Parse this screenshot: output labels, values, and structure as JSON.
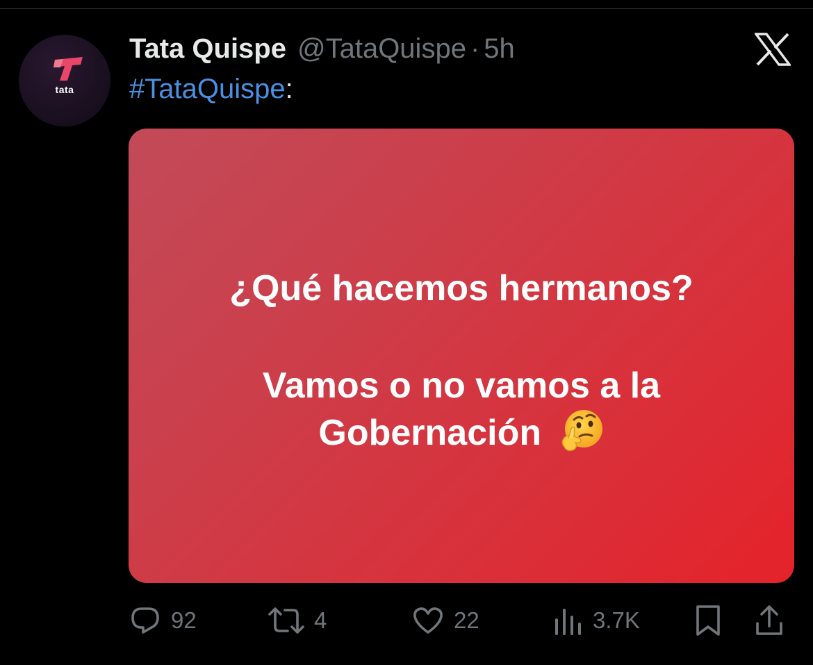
{
  "tweet": {
    "display_name": "Tata Quispe",
    "handle": "@TataQuispe",
    "separator": "·",
    "time": "5h",
    "hashtag": "#TataQuispe",
    "after_hashtag": ":",
    "avatar_label": "tata"
  },
  "media": {
    "line1": "¿Qué hacemos hermanos?",
    "line2": "Vamos o no vamos a la",
    "line3": "Gobernación",
    "emoji": "thinking-face"
  },
  "actions": {
    "replies": "92",
    "reposts": "4",
    "likes": "22",
    "views": "3.7K"
  },
  "colors": {
    "background": "#000000",
    "hashtag": "#4a90e2",
    "muted": "#71767b",
    "card_start": "#c24a58",
    "card_end": "#e5222a",
    "brand_pink": "#e8476a"
  },
  "icons": [
    "x-logo-icon",
    "reply-icon",
    "repost-icon",
    "like-icon",
    "views-icon",
    "bookmark-icon",
    "share-icon"
  ]
}
